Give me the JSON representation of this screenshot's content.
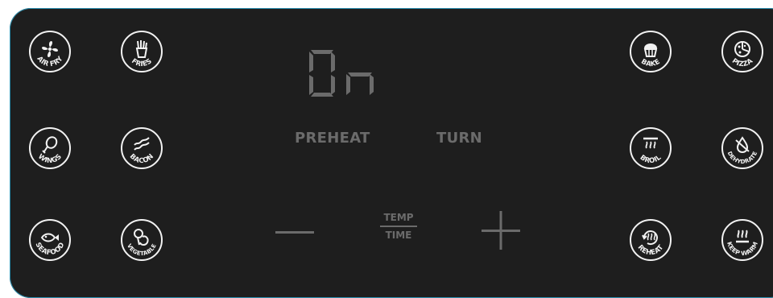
{
  "display": {
    "readout": "On"
  },
  "labels": {
    "preheat": "PREHEAT",
    "turn": "TURN",
    "temp": "TEMP",
    "time": "TIME"
  },
  "presets": {
    "air_fry": "AIR FRY",
    "fries": "FRIES",
    "wings": "WINGS",
    "bacon": "BACON",
    "seafood": "SEAFOOD",
    "vegetable": "VEGETABLE",
    "bake": "BAKE",
    "pizza": "PIZZA",
    "broil": "BROIL",
    "dehydrate": "DEHYDRATE",
    "reheat": "REHEAT",
    "keep_warm": "KEEP WARM"
  },
  "colors": {
    "panel": "#1e1e1e",
    "icon": "#f2f2f2",
    "dim": "#6b6b6b",
    "border": "#2a8fb0"
  }
}
